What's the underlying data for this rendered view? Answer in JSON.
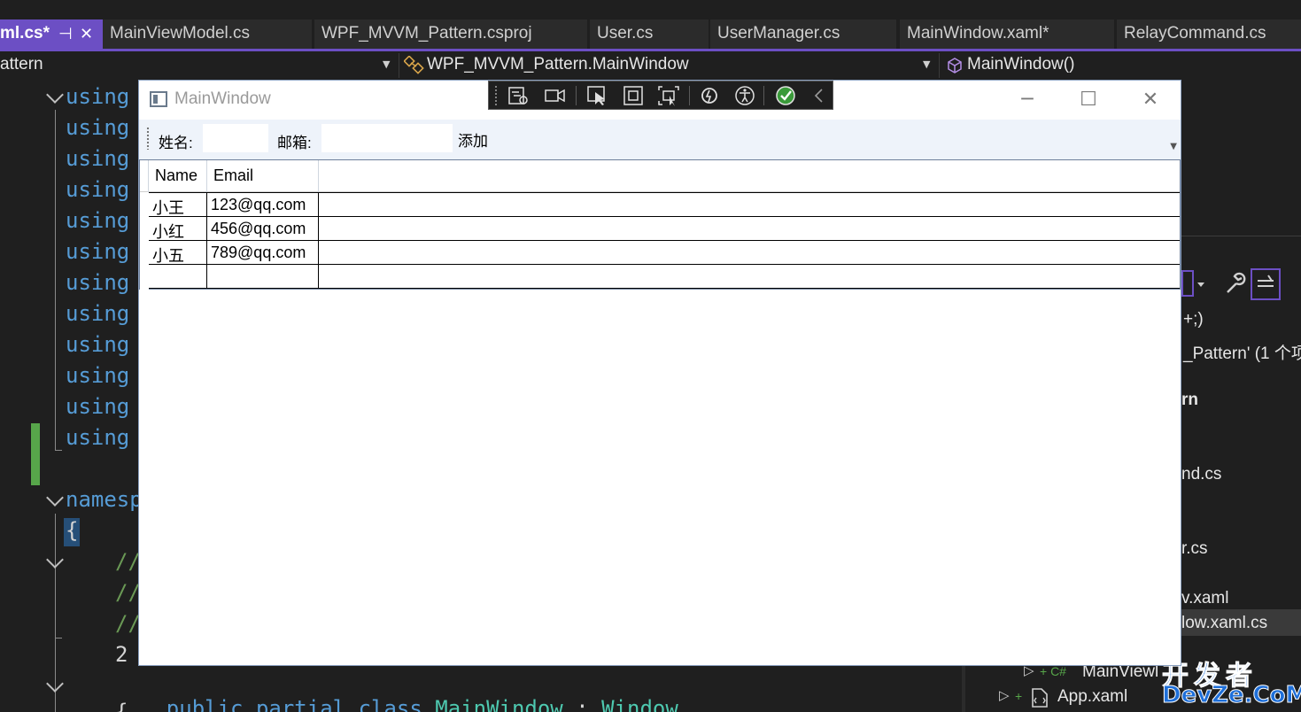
{
  "tabs": [
    {
      "label": "ml.cs*",
      "active": true
    },
    {
      "label": "MainViewModel.cs"
    },
    {
      "label": "WPF_MVVM_Pattern.csproj"
    },
    {
      "label": "User.cs"
    },
    {
      "label": "UserManager.cs"
    },
    {
      "label": "MainWindow.xaml*"
    },
    {
      "label": "RelayCommand.cs"
    }
  ],
  "navbar": {
    "project": "attern",
    "class_scope": "WPF_MVVM_Pattern.MainWindow",
    "member_scope": "MainWindow()"
  },
  "code": {
    "using_keyword": "using",
    "namespace_fragment": "namesp",
    "open_brace": "{",
    "comment_fragment": "//",
    "line_number_fragment": "2",
    "class_line": {
      "kw1": "public",
      "kw2": "partial",
      "kw3": "class",
      "name": "MainWindow",
      "colon": ":",
      "base": "Window"
    },
    "next_brace": "{"
  },
  "right_panel": {
    "line1": "+;)",
    "line2": "_Pattern' (1 个项",
    "line3": "rn",
    "line4": "nd.cs",
    "line5": "r.cs",
    "line6": "v.xaml",
    "line7": "low.xaml.cs",
    "line8": "MainViewl",
    "line9": "App.xaml"
  },
  "watermark": {
    "top": "开发者",
    "bottom": "DevZe.CoM"
  },
  "wpf_window": {
    "title": "MainWindow",
    "toolbar": {
      "name_label": "姓名:",
      "name_value": "",
      "email_label": "邮箱:",
      "email_value": "",
      "add_button": "添加"
    },
    "grid": {
      "columns": [
        "Name",
        "Email"
      ],
      "rows": [
        {
          "name": "小王",
          "email": "123@qq.com"
        },
        {
          "name": "小红",
          "email": "456@qq.com"
        },
        {
          "name": "小五",
          "email": "789@qq.com"
        },
        {
          "name": "",
          "email": ""
        }
      ]
    }
  },
  "icons": {
    "debug_toolbar": [
      "live-visual-tree-icon",
      "record-icon",
      "select-element-icon",
      "display-adorners-icon",
      "track-focus-icon",
      "hot-reload-icon",
      "accessibility-icon",
      "check-icon",
      "collapse-icon"
    ]
  },
  "colors": {
    "tab_accent": "#6c4fc4",
    "keyword": "#569cd6",
    "type": "#4ec9b0",
    "comment": "#6a9955",
    "changebar": "#57a64a"
  }
}
